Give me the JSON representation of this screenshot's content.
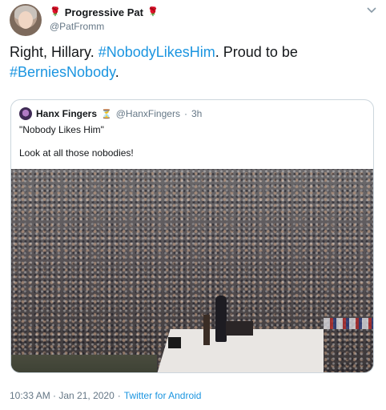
{
  "author": {
    "display_name": "Progressive Pat",
    "handle": "@PatFromm",
    "name_emoji": "🌹"
  },
  "tweet": {
    "text_before": "Right, Hillary. ",
    "hashtag_1": "#NobodyLikesHim",
    "text_middle": ". Proud to be ",
    "hashtag_2": "#BerniesNobody",
    "text_after": "."
  },
  "quoted_tweet": {
    "display_name": "Hanx Fingers",
    "name_emoji": "⏳",
    "handle": "@HanxFingers",
    "separator": "·",
    "time": "3h",
    "line1": "\"Nobody Likes Him\"",
    "line2": "Look at all those nobodies!"
  },
  "footer": {
    "timestamp": "10:33 AM · Jan 21, 2020",
    "separator": "·",
    "source": "Twitter for Android"
  },
  "icons": {
    "menu": "chevron-down-icon"
  },
  "colors": {
    "link": "#1b95e0",
    "secondary_text": "#657786",
    "border": "#ccd6dd"
  }
}
